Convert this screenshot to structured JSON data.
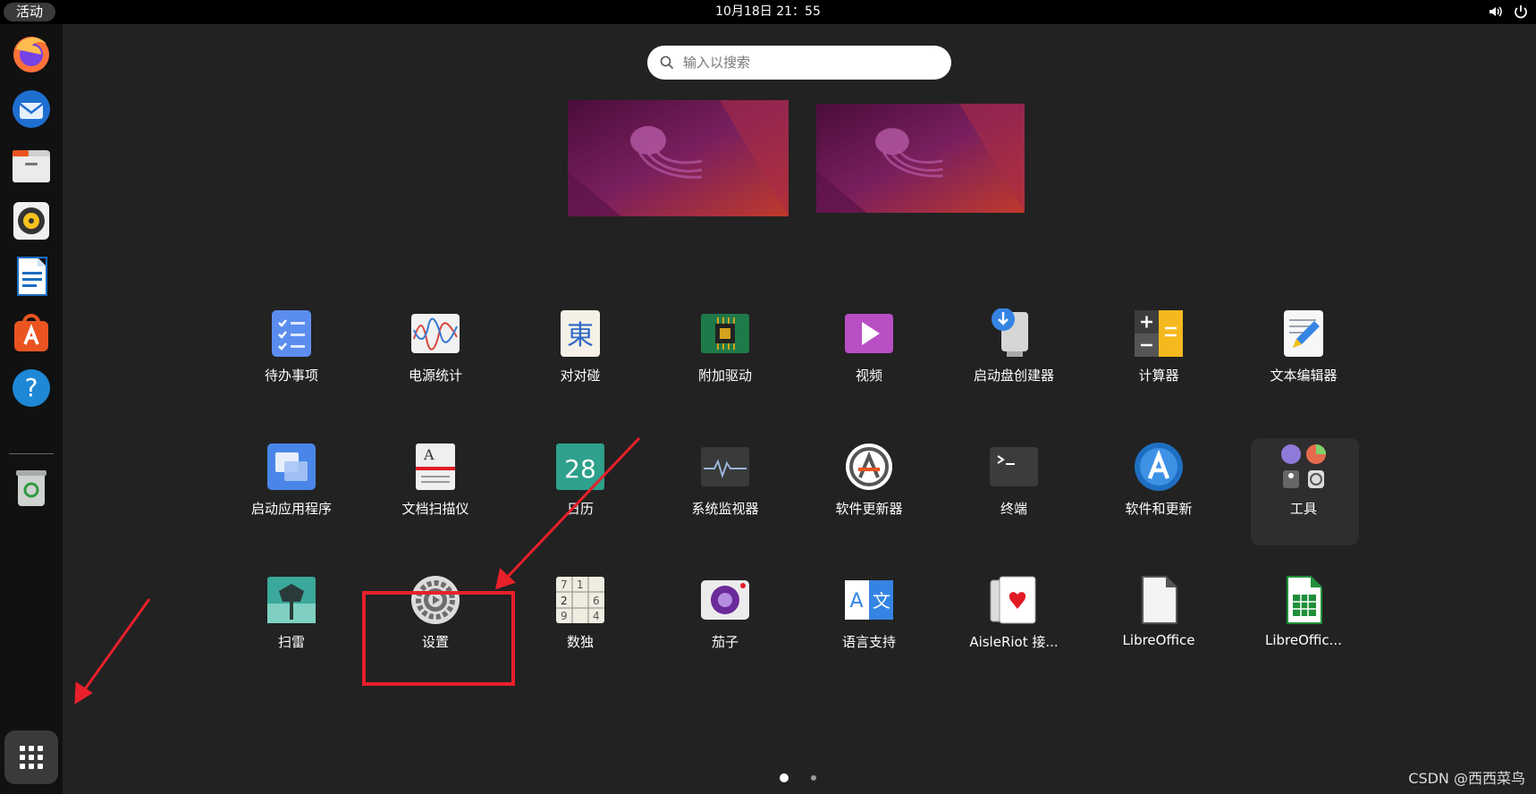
{
  "topbar": {
    "activities_label": "活动",
    "clock": "10月18日  21：55",
    "tray_icons": [
      "volume-icon",
      "power-icon"
    ]
  },
  "dock": {
    "items": [
      {
        "name": "Firefox",
        "icon": "firefox-icon"
      },
      {
        "name": "Thunderbird",
        "icon": "thunderbird-icon"
      },
      {
        "name": "Files",
        "icon": "files-icon"
      },
      {
        "name": "Rhythmbox",
        "icon": "rhythmbox-icon"
      },
      {
        "name": "LibreOffice Writer",
        "icon": "writer-icon"
      },
      {
        "name": "Ubuntu Software",
        "icon": "software-icon"
      },
      {
        "name": "Help",
        "icon": "help-icon"
      },
      {
        "name": "Trash",
        "icon": "trash-icon"
      }
    ],
    "show_apps_icon": "app-grid-icon"
  },
  "search": {
    "placeholder": "输入以搜索"
  },
  "apps": [
    {
      "label": "待办事项",
      "icon": "todo-icon"
    },
    {
      "label": "电源统计",
      "icon": "power-stats-icon"
    },
    {
      "label": "对对碰",
      "icon": "mahjongg-icon"
    },
    {
      "label": "附加驱动",
      "icon": "drivers-chip-icon"
    },
    {
      "label": "视频",
      "icon": "video-play-icon"
    },
    {
      "label": "启动盘创建器",
      "icon": "usb-creator-icon"
    },
    {
      "label": "计算器",
      "icon": "calculator-icon"
    },
    {
      "label": "文本编辑器",
      "icon": "text-editor-icon"
    },
    {
      "label": "启动应用程序",
      "icon": "startup-apps-icon"
    },
    {
      "label": "文档扫描仪",
      "icon": "scanner-icon"
    },
    {
      "label": "日历",
      "icon": "calendar-icon",
      "day": "28"
    },
    {
      "label": "系统监视器",
      "icon": "system-monitor-icon"
    },
    {
      "label": "软件更新器",
      "icon": "software-updater-icon"
    },
    {
      "label": "终端",
      "icon": "terminal-icon"
    },
    {
      "label": "软件和更新",
      "icon": "software-properties-icon"
    },
    {
      "label": "工具",
      "icon": "tools-folder-icon"
    },
    {
      "label": "扫雷",
      "icon": "mines-icon"
    },
    {
      "label": "设置",
      "icon": "settings-gear-icon"
    },
    {
      "label": "数独",
      "icon": "sudoku-icon"
    },
    {
      "label": "茄子",
      "icon": "cheese-camera-icon"
    },
    {
      "label": "语言支持",
      "icon": "language-support-icon"
    },
    {
      "label": "AisleRiot 接...",
      "icon": "cards-icon"
    },
    {
      "label": "LibreOffice",
      "icon": "libreoffice-icon"
    },
    {
      "label": "LibreOffic...",
      "icon": "calc-icon"
    }
  ],
  "watermark": "CSDN @西西菜鸟",
  "colors": {
    "background": "#222222",
    "highlight": "#e8202a",
    "accent_orange": "#e95420"
  }
}
